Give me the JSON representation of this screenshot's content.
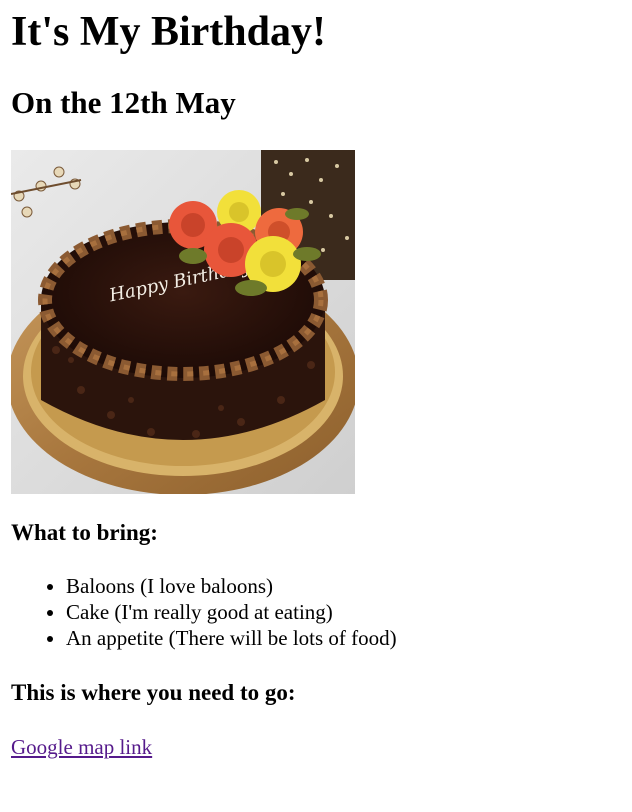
{
  "header": {
    "title": "It's My Birthday!",
    "subtitle": "On the 12th May"
  },
  "image": {
    "alt": "Chocolate birthday cake",
    "text": "Happy Birthday"
  },
  "bring": {
    "heading": "What to bring:",
    "items": [
      "Baloons (I love baloons)",
      "Cake (I'm really good at eating)",
      "An appetite (There will be lots of food)"
    ]
  },
  "location": {
    "heading": "This is where you need to go:",
    "link_label": "Google map link"
  }
}
